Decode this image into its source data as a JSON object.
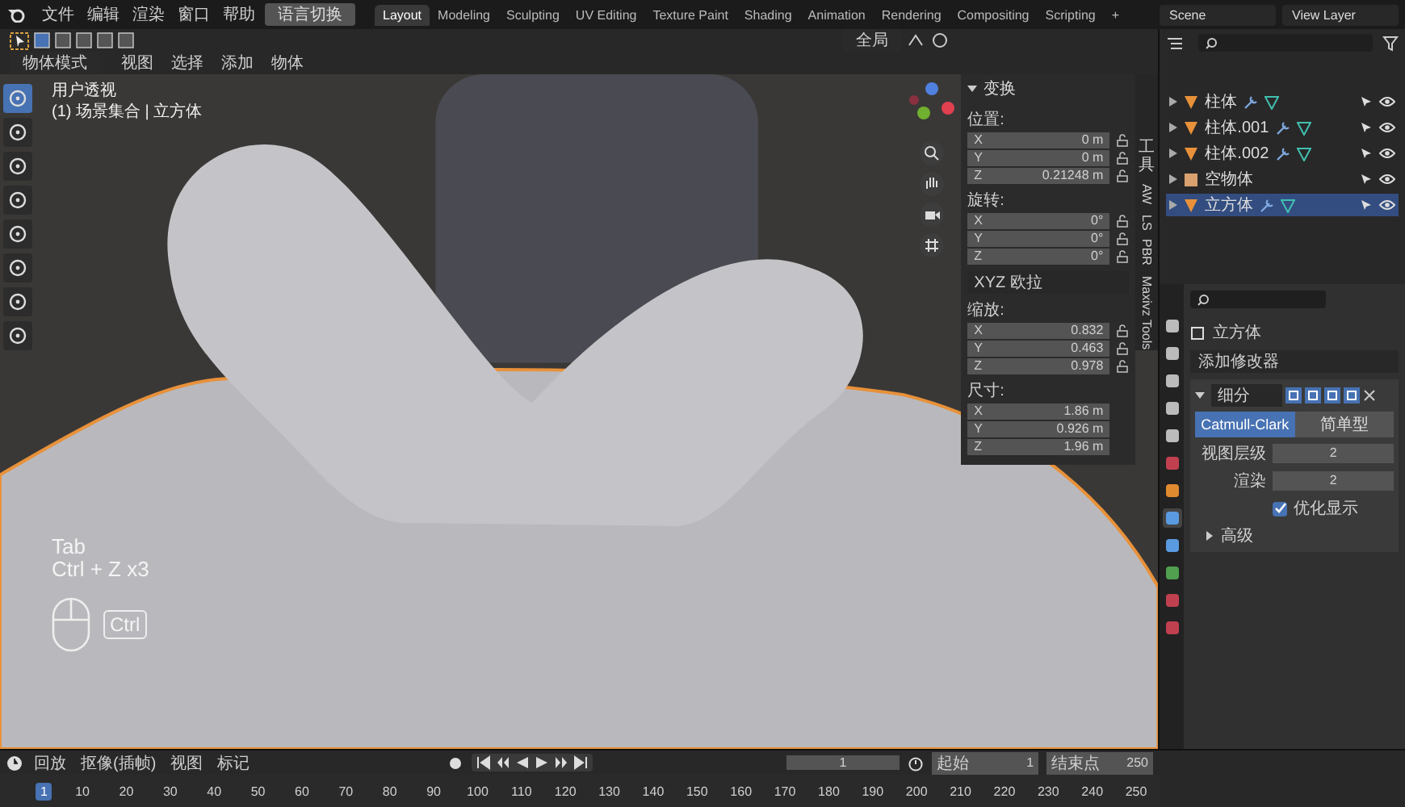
{
  "menu": [
    "文件",
    "编辑",
    "渲染",
    "窗口",
    "帮助"
  ],
  "language_button": "语言切换",
  "workspaces": [
    {
      "label": "Layout",
      "selected": true
    },
    {
      "label": "Modeling",
      "selected": false
    },
    {
      "label": "Sculpting",
      "selected": false
    },
    {
      "label": "UV Editing",
      "selected": false
    },
    {
      "label": "Texture Paint",
      "selected": false
    },
    {
      "label": "Shading",
      "selected": false
    },
    {
      "label": "Animation",
      "selected": false
    },
    {
      "label": "Rendering",
      "selected": false
    },
    {
      "label": "Compositing",
      "selected": false
    },
    {
      "label": "Scripting",
      "selected": false
    }
  ],
  "add_workspace": "+",
  "scene": "Scene",
  "view_layer": "View Layer",
  "viewport": {
    "transform_orientation": "全局",
    "mode": "物体模式",
    "menus": [
      "视图",
      "选择",
      "添加",
      "物体"
    ],
    "view_name": "用户透视",
    "context": "(1) 场景集合 | 立方体",
    "key_hints": [
      "Tab",
      "Ctrl + Z x3"
    ],
    "mouse_key": "Ctrl"
  },
  "sidebar": {
    "panel_title": "变换",
    "expanded": true,
    "groups": [
      {
        "kind": "vector",
        "label": "位置:",
        "locks": true,
        "rows": [
          {
            "axis": "X",
            "value": "0 m"
          },
          {
            "axis": "Y",
            "value": "0 m"
          },
          {
            "axis": "Z",
            "value": "0.21248 m"
          }
        ]
      },
      {
        "kind": "vector",
        "label": "旋转:",
        "locks": true,
        "rows": [
          {
            "axis": "X",
            "value": "0°"
          },
          {
            "axis": "Y",
            "value": "0°"
          },
          {
            "axis": "Z",
            "value": "0°"
          }
        ]
      },
      {
        "kind": "dropdown",
        "value": "XYZ 欧拉"
      },
      {
        "kind": "vector",
        "label": "缩放:",
        "locks": true,
        "rows": [
          {
            "axis": "X",
            "value": "0.832"
          },
          {
            "axis": "Y",
            "value": "0.463"
          },
          {
            "axis": "Z",
            "value": "0.978"
          }
        ]
      },
      {
        "kind": "vector",
        "label": "尺寸:",
        "locks": false,
        "rows": [
          {
            "axis": "X",
            "value": "1.86 m"
          },
          {
            "axis": "Y",
            "value": "0.926 m"
          },
          {
            "axis": "Z",
            "value": "1.96 m"
          }
        ]
      }
    ],
    "tabs": [
      {
        "label": "工具",
        "kind": "cjk"
      },
      {
        "label": "AW",
        "kind": "latin"
      },
      {
        "label": "LS",
        "kind": "latin"
      },
      {
        "label": "PBR",
        "kind": "latin"
      },
      {
        "label": "Maxivz Tools",
        "kind": "latin"
      }
    ]
  },
  "outliner": {
    "items": [
      {
        "name": "柱体",
        "kind": "mesh",
        "modifier": true,
        "selected": false
      },
      {
        "name": "柱体.001",
        "kind": "mesh",
        "modifier": true,
        "selected": false
      },
      {
        "name": "柱体.002",
        "kind": "mesh",
        "modifier": true,
        "selected": false
      },
      {
        "name": "空物体",
        "kind": "empty",
        "modifier": false,
        "selected": false
      },
      {
        "name": "立方体",
        "kind": "mesh",
        "modifier": true,
        "selected": true
      }
    ]
  },
  "properties": {
    "object_name": "立方体",
    "add_modifier": "添加修改器",
    "modifier": {
      "name": "细分",
      "expanded": true,
      "types": [
        {
          "label": "Catmull-Clark",
          "selected": true
        },
        {
          "label": "简单型",
          "selected": false
        }
      ],
      "fields": [
        {
          "label": "视图层级",
          "value": "2"
        },
        {
          "label": "渲染",
          "value": "2"
        }
      ],
      "option": {
        "label": "优化显示",
        "checked": true
      },
      "advanced": {
        "label": "高级",
        "expanded": false
      }
    }
  },
  "timeline": {
    "menus": [
      "回放",
      "抠像(插帧)",
      "视图",
      "标记"
    ],
    "current_frame": "1",
    "start_label": "起始",
    "start": "1",
    "end_label": "结束点",
    "end": "250",
    "playhead": "1",
    "ruler": [
      "10",
      "20",
      "30",
      "40",
      "50",
      "60",
      "70",
      "80",
      "90",
      "100",
      "110",
      "120",
      "130",
      "140",
      "150",
      "160",
      "170",
      "180",
      "190",
      "200",
      "210",
      "220",
      "230",
      "240",
      "250"
    ]
  }
}
